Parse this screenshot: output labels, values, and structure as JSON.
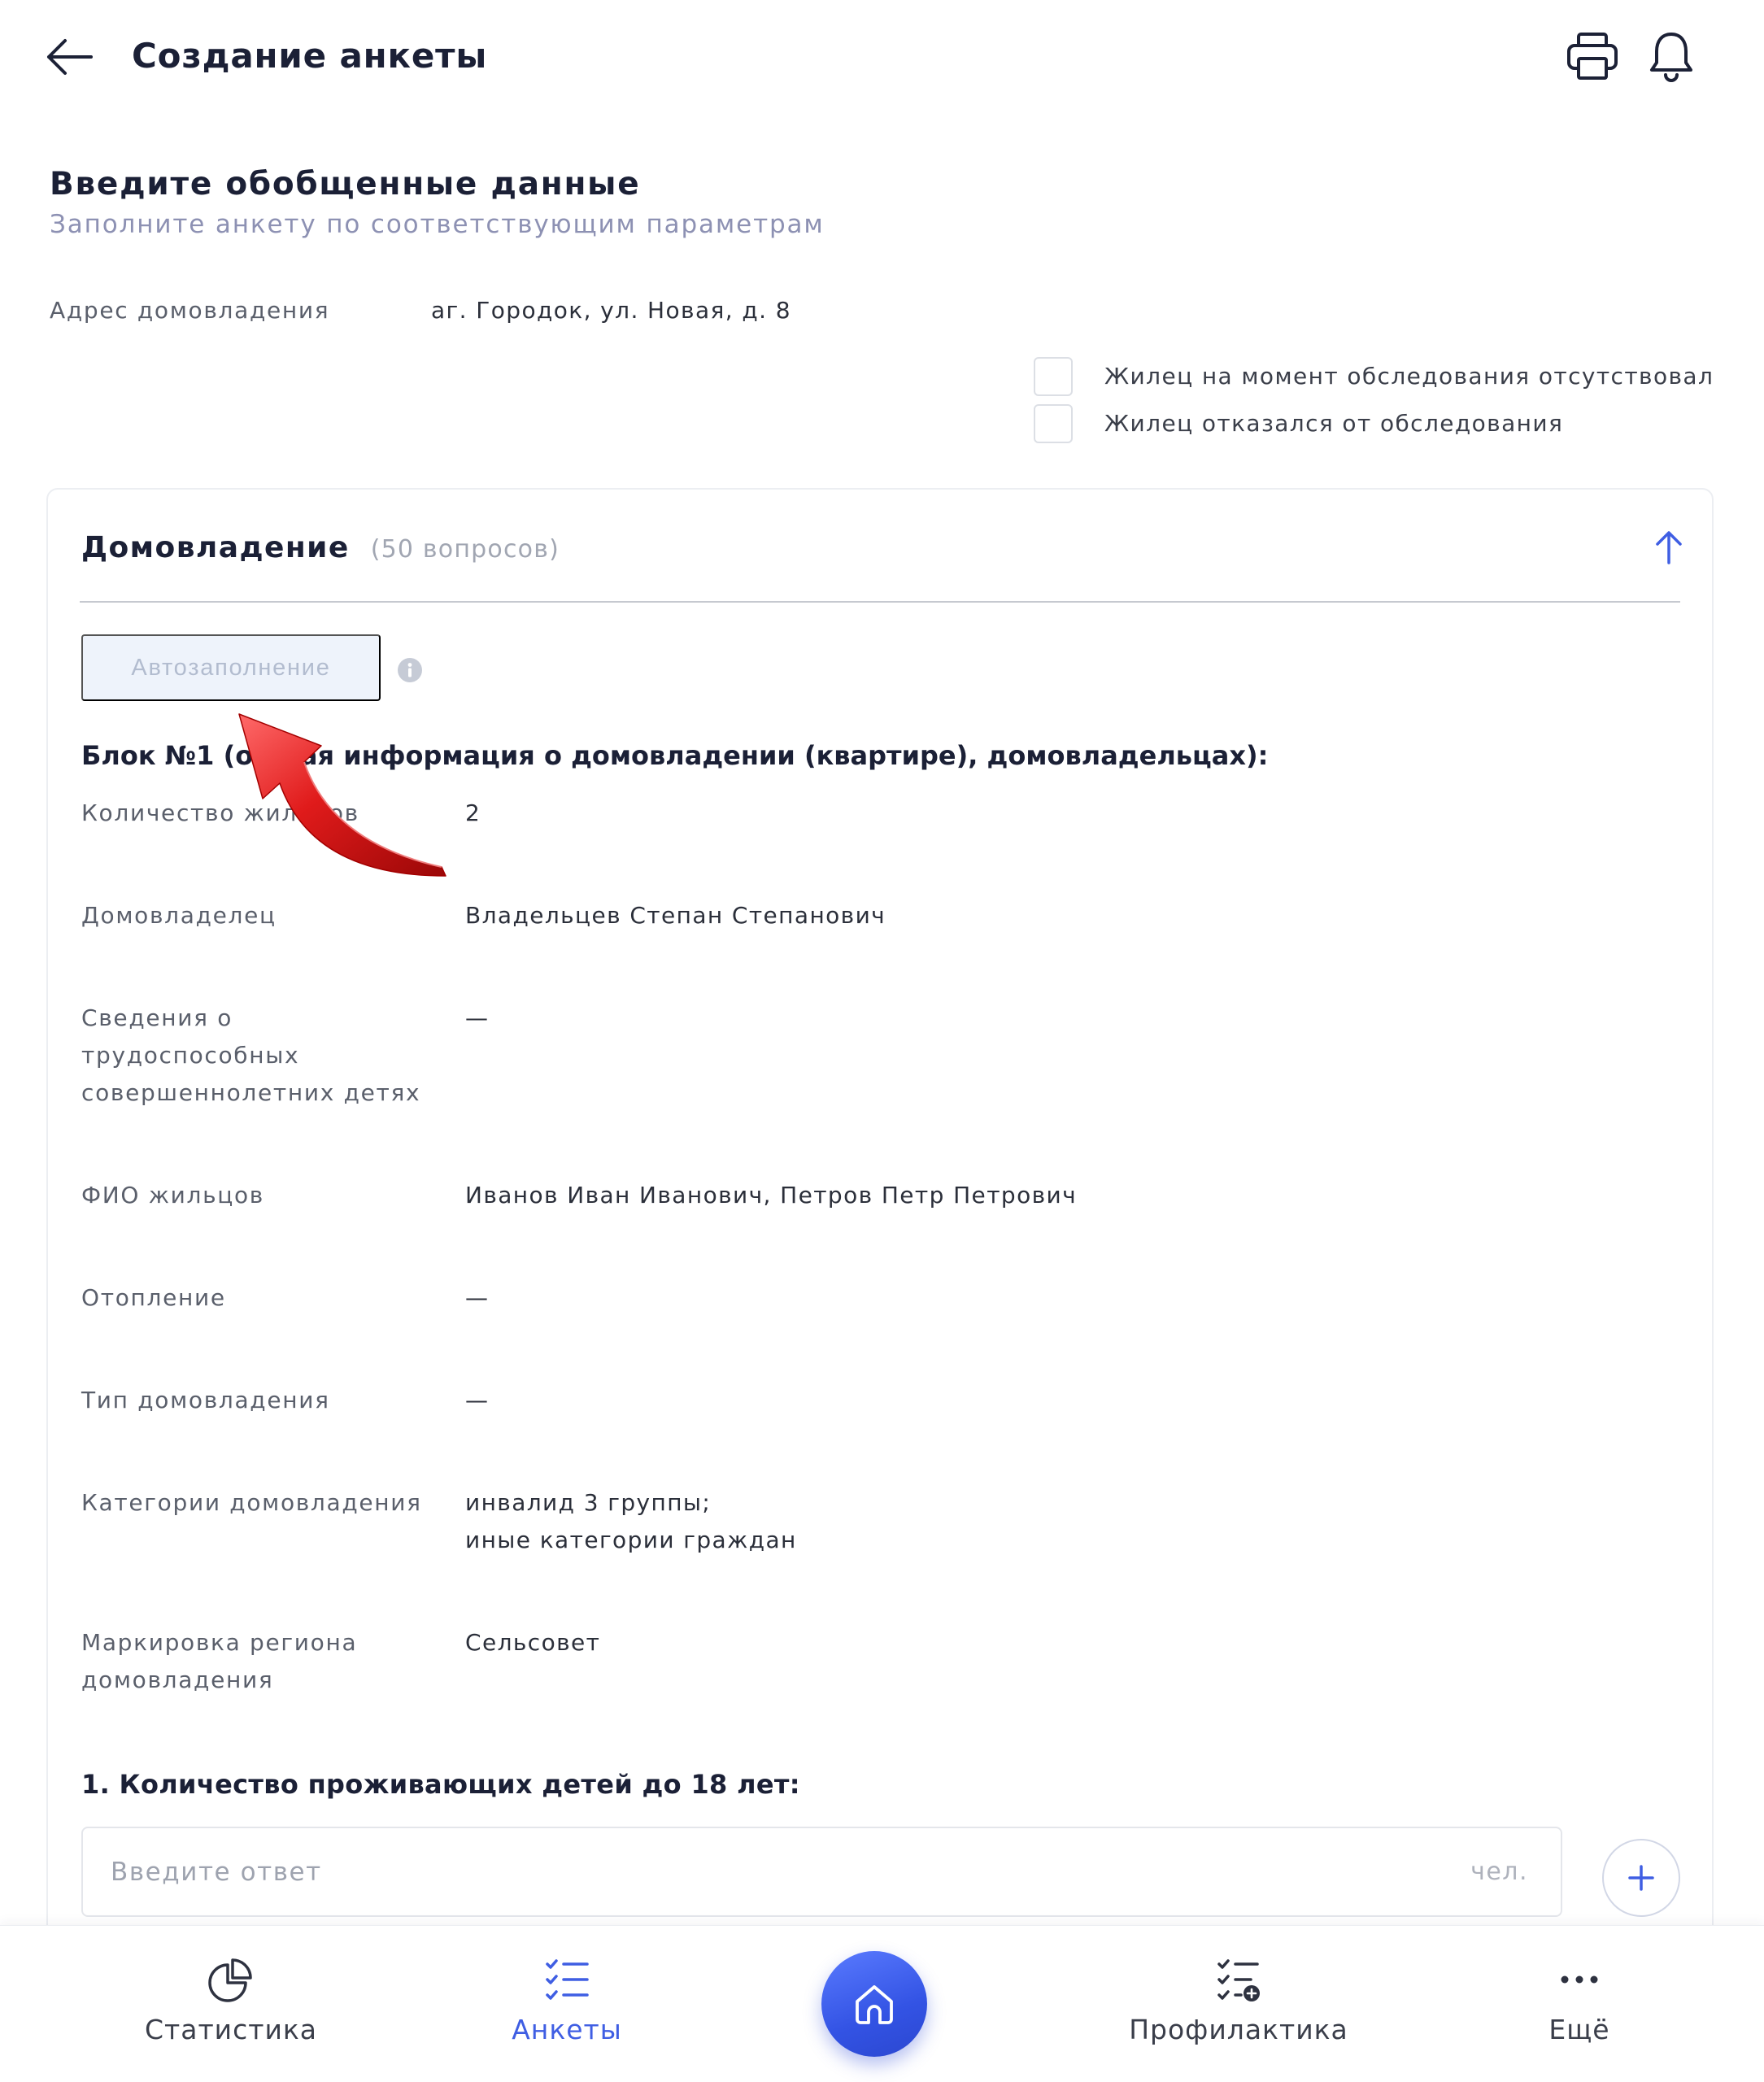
{
  "header": {
    "title": "Создание анкеты",
    "icons": [
      "back-arrow-icon",
      "printer-icon",
      "bell-icon"
    ]
  },
  "intro": {
    "title": "Введите обобщенные данные",
    "subtitle": "Заполните анкету по соответствующим параметрам"
  },
  "address": {
    "label": "Адрес домовладения",
    "value": "аг. Городок, ул. Новая, д. 8"
  },
  "checkboxes": [
    {
      "label": "Жилец на момент обследования отсутствовал",
      "checked": false
    },
    {
      "label": "Жилец отказался от обследования",
      "checked": false
    }
  ],
  "section": {
    "title": "Домовладение",
    "count": "(50 вопросов)",
    "expanded": true,
    "autofill_label": "Автозаполнение",
    "block_title": "Блок №1 (общая информация о домовладении (квартире), домовладельцах):",
    "rows": [
      {
        "label": "Количество жильцов",
        "value": "2"
      },
      {
        "label": "Домовладелец",
        "value": "Владельцев Степан Степанович"
      },
      {
        "label": "Сведения о\nтрудоспособных\nсовершеннолетних детях",
        "value": "—"
      },
      {
        "label": "ФИО жильцов",
        "value": "Иванов Иван Иванович, Петров Петр Петрович"
      },
      {
        "label": "Отопление",
        "value": "—"
      },
      {
        "label": "Тип домовладения",
        "value": "—"
      },
      {
        "label": "Категории домовладения",
        "value": "инвалид 3 группы;\nиные категории граждан"
      },
      {
        "label": "Маркировка региона\nдомовладения",
        "value": "Сельсовет"
      }
    ]
  },
  "question": {
    "title": "1. Количество проживающих детей до 18 лет:",
    "placeholder": "Введите ответ",
    "unit": "чел."
  },
  "nav": {
    "home_icon": "home-icon",
    "items": [
      {
        "label": "Статистика",
        "icon": "pie-chart-icon",
        "active": false
      },
      {
        "label": "Анкеты",
        "icon": "checklist-icon",
        "active": true
      },
      {
        "label": "Профилактика",
        "icon": "checklist-add-icon",
        "active": false
      },
      {
        "label": "Ещё",
        "icon": "more-dots-icon",
        "active": false
      }
    ]
  },
  "colors": {
    "accent": "#3f5ee3",
    "text": "#1b2036",
    "muted": "#8d91b3",
    "annotation": "#dd1a1a"
  }
}
